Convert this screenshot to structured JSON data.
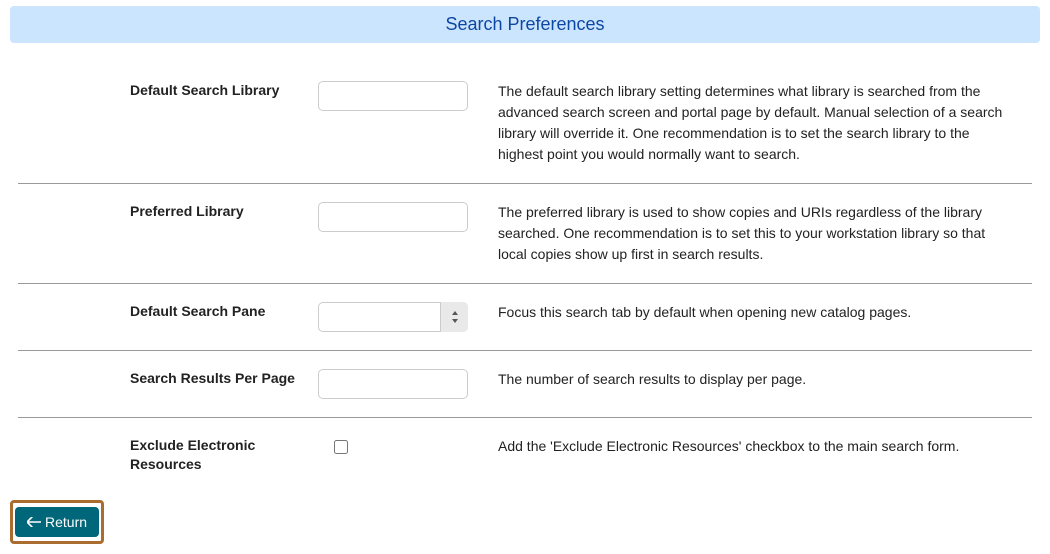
{
  "banner": {
    "title": "Search Preferences"
  },
  "rows": {
    "default_library": {
      "label": "Default Search Library",
      "value": "",
      "desc": "The default search library setting determines what library is searched from the advanced search screen and portal page by default. Manual selection of a search library will override it. One recommendation is to set the search library to the highest point you would normally want to search."
    },
    "preferred_library": {
      "label": "Preferred Library",
      "value": "",
      "desc": "The preferred library is used to show copies and URIs regardless of the library searched. One recommendation is to set this to your workstation library so that local copies show up first in search results."
    },
    "default_pane": {
      "label": "Default Search Pane",
      "value": "",
      "desc": "Focus this search tab by default when opening new catalog pages."
    },
    "results_per_page": {
      "label": "Search Results Per Page",
      "value": "",
      "desc": "The number of search results to display per page."
    },
    "exclude_electronic": {
      "label": "Exclude Electronic Resources",
      "checked": false,
      "desc": "Add the 'Exclude Electronic Resources' checkbox to the main search form."
    }
  },
  "return_button": {
    "label": "Return"
  }
}
